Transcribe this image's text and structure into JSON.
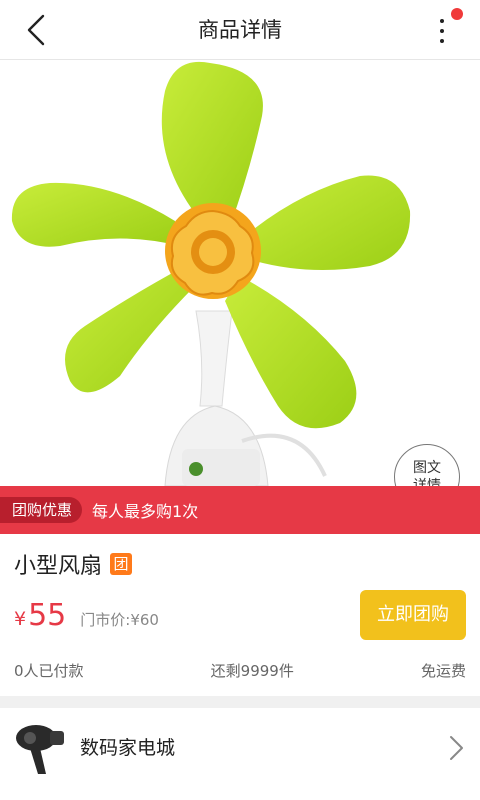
{
  "header": {
    "title": "商品详情",
    "back_icon": "chevron-left-icon",
    "more_icon": "more-vertical-icon",
    "notify_color": "#f03a3a"
  },
  "hero": {
    "image": "yellow-green electric fan product photo",
    "detail_bubble": {
      "line1": "图文",
      "line2": "详情"
    }
  },
  "promo": {
    "tag": "团购优惠",
    "text": "每人最多购1次",
    "color": "#e63946"
  },
  "product": {
    "name": "小型风扇",
    "badge": "团",
    "currency": "¥",
    "price": "55",
    "market_price": "门市价:¥60",
    "buy_label": "立即团购",
    "buy_color": "#f2c11c"
  },
  "stats": {
    "paid": "0人已付款",
    "remaining": "还剩9999件",
    "shipping": "免运费"
  },
  "store": {
    "name": "数码家电城",
    "icon": "hair-dryer-icon"
  }
}
